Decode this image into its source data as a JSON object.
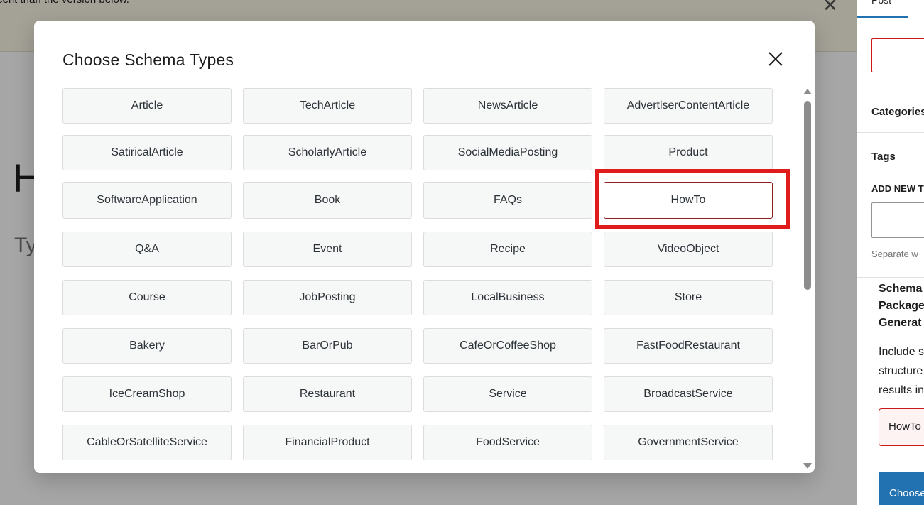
{
  "background": {
    "notice_text": "cent than the version below.",
    "title_fragment": "H",
    "placeholder_fragment": "Ty"
  },
  "sidebar": {
    "tab_post": "Post",
    "categories_label": "Categories",
    "tags_label": "Tags",
    "add_new_tag_label": "ADD NEW T",
    "separate_hint": "Separate w",
    "schema_panel": {
      "title_line1": "Schema",
      "title_line2": "Package",
      "title_line3": "Generat",
      "desc_line1": "Include s",
      "desc_line2": "structure",
      "desc_line3": "results in"
    },
    "selected_chip": "HowTo",
    "choose_button": "Choose"
  },
  "modal": {
    "title": "Choose Schema Types",
    "close_icon": "close-icon",
    "selected_type": "HowTo",
    "types": [
      "Article",
      "TechArticle",
      "NewsArticle",
      "AdvertiserContentArticle",
      "SatiricalArticle",
      "ScholarlyArticle",
      "SocialMediaPosting",
      "Product",
      "SoftwareApplication",
      "Book",
      "FAQs",
      "HowTo",
      "Q&A",
      "Event",
      "Recipe",
      "VideoObject",
      "Course",
      "JobPosting",
      "LocalBusiness",
      "Store",
      "Bakery",
      "BarOrPub",
      "CafeOrCoffeeShop",
      "FastFoodRestaurant",
      "IceCreamShop",
      "Restaurant",
      "Service",
      "BroadcastService",
      "CableOrSatelliteService",
      "FinancialProduct",
      "FoodService",
      "GovernmentService",
      "",
      "",
      "",
      ""
    ]
  },
  "colors": {
    "highlight": "#e01b1b",
    "selected_border": "#8a1f1f",
    "accent": "#2271b1"
  }
}
